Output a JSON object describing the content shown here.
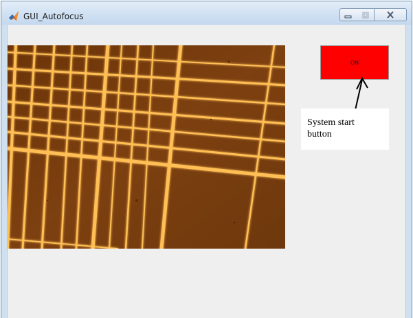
{
  "window": {
    "title": "GUI_Autofocus",
    "titlebar_color": "#d3e3f4"
  },
  "controls": {
    "minimize_icon": "minimize-icon",
    "maximize_icon": "maximize-icon",
    "close_icon": "close-icon"
  },
  "camera_view": {
    "icon": "microscope-image",
    "background_color": "#7a3e0d",
    "line_color": "#ffbf55"
  },
  "on_button": {
    "label": "ON",
    "color": "#ff0000"
  },
  "annotation": {
    "text_line1": "System start",
    "text_line2": "button"
  }
}
